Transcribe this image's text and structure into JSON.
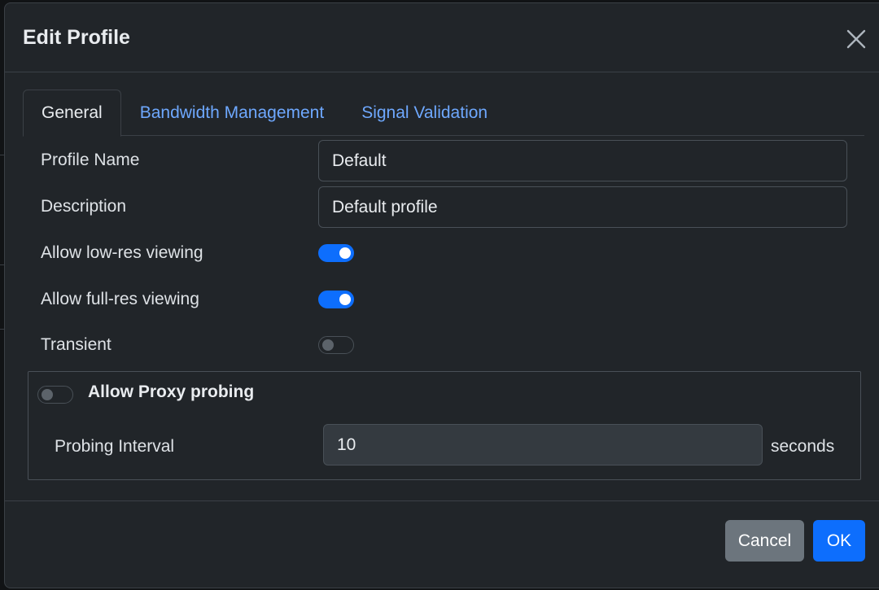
{
  "dialog": {
    "title": "Edit Profile"
  },
  "tabs": [
    {
      "label": "General",
      "active": true
    },
    {
      "label": "Bandwidth Management",
      "active": false
    },
    {
      "label": "Signal Validation",
      "active": false
    }
  ],
  "fields": {
    "profile_name": {
      "label": "Profile Name",
      "value": "Default"
    },
    "description": {
      "label": "Description",
      "value": "Default profile"
    },
    "low_res": {
      "label": "Allow low-res viewing",
      "checked": true
    },
    "full_res": {
      "label": "Allow full-res viewing",
      "checked": true
    },
    "transient": {
      "label": "Transient",
      "checked": false
    }
  },
  "proxy": {
    "title": "Allow Proxy probing",
    "enabled": false,
    "interval_label": "Probing Interval",
    "interval_value": "10",
    "interval_unit": "seconds"
  },
  "footer": {
    "cancel_label": "Cancel",
    "ok_label": "OK"
  },
  "colors": {
    "accent": "#0d6efd",
    "link": "#6ea8fe",
    "background": "#212529",
    "secondary": "#6c757d"
  }
}
